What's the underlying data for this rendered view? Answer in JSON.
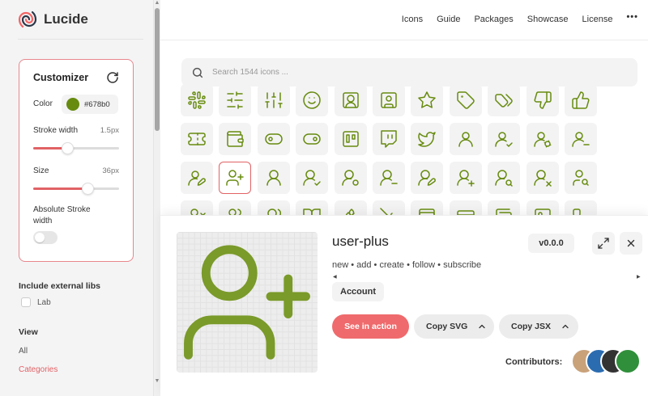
{
  "app": {
    "name": "Lucide"
  },
  "nav": {
    "items": [
      "Icons",
      "Guide",
      "Packages",
      "Showcase",
      "License"
    ],
    "more": "•••"
  },
  "customizer": {
    "title": "Customizer",
    "color_label": "Color",
    "color_value": "#678b0",
    "color_hex": "#678b0f",
    "stroke_label": "Stroke width",
    "stroke_value": "1.5px",
    "stroke_fraction": 0.4,
    "size_label": "Size",
    "size_value": "36px",
    "size_fraction": 0.63,
    "absolute_label": "Absolute Stroke width",
    "absolute_enabled": false
  },
  "sidebar": {
    "external_libs_title": "Include external libs",
    "external_libs": [
      {
        "label": "Lab",
        "checked": false
      }
    ],
    "view_title": "View",
    "view_items": [
      {
        "label": "All",
        "active": false
      },
      {
        "label": "Categories",
        "active": true
      }
    ]
  },
  "search": {
    "placeholder": "Search 1544 icons ..."
  },
  "grid": {
    "selected_icon": "user-plus",
    "rows": [
      [
        "slack-icon",
        "sliders-horizontal-icon",
        "sliders-vertical-icon",
        "smile-icon",
        "square-user-round-icon",
        "square-user-icon",
        "star-icon",
        "tag-icon",
        "tags-icon",
        "thumbs-down-icon",
        "thumbs-up-icon"
      ],
      [
        "ticket-icon",
        "wallet-icon",
        "toggle-left-icon",
        "toggle-right-icon",
        "trello-icon",
        "twitch-icon",
        "twitter-icon",
        "user-icon",
        "user-check-icon",
        "user-cog-icon",
        "user-minus-icon"
      ],
      [
        "user-pen-icon",
        "user-plus-icon",
        "user-round-icon",
        "user-round-check-icon",
        "user-round-cog-icon",
        "user-round-minus-icon",
        "user-round-pen-icon",
        "user-round-plus-icon",
        "user-round-search-icon",
        "user-round-x-icon",
        "user-search-icon"
      ],
      [
        "user-x-icon",
        "users-icon",
        "users-round-icon",
        "book-open-icon",
        "wheat-icon",
        "wheat-off-icon",
        "wallet-cards-icon",
        "credit-card-icon",
        "wallet-minimal-icon",
        "image-icon",
        "workflow-icon"
      ]
    ]
  },
  "detail": {
    "name": "user-plus",
    "version": "v0.0.0",
    "tags": "new • add • create • follow • subscribe",
    "category": "Account",
    "see_in_action": "See in action",
    "copy_svg": "Copy SVG",
    "copy_jsx": "Copy JSX",
    "contributors_label": "Contributors:",
    "contributor_colors": [
      "#c9a27a",
      "#2b6cb0",
      "#333333",
      "#2f8f3a"
    ]
  },
  "colors": {
    "accent": "#e26265",
    "icon": "#678b0f"
  }
}
